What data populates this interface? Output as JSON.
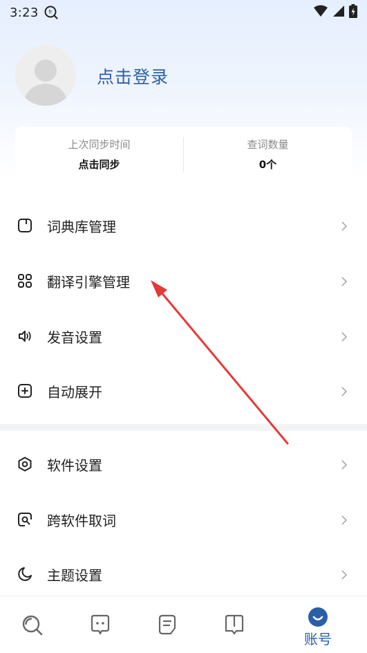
{
  "status_bar": {
    "time": "3:23",
    "app_icon": "ocr-scan-icon",
    "icons": [
      "wifi-icon",
      "signal-icon",
      "battery-icon"
    ]
  },
  "profile": {
    "login_label": "点击登录",
    "avatar_icon": "default-avatar-icon"
  },
  "stats": {
    "sync": {
      "label": "上次同步时间",
      "value": "点击同步"
    },
    "lookup": {
      "label": "查词数量",
      "value": "0个"
    }
  },
  "menu": {
    "dictionary": "词典库管理",
    "engine": "翻译引擎管理",
    "pronunciation": "发音设置",
    "auto_expand": "自动展开",
    "software_settings": "软件设置",
    "cross_app": "跨软件取词",
    "theme": "主题设置"
  },
  "bottom_nav": {
    "items": [
      "search-icon",
      "translate-icon",
      "notes-icon",
      "book-icon",
      "account-icon"
    ],
    "active_label": "账号"
  },
  "colors": {
    "accent": "#2a5fa8",
    "annotation": "#e53935"
  }
}
